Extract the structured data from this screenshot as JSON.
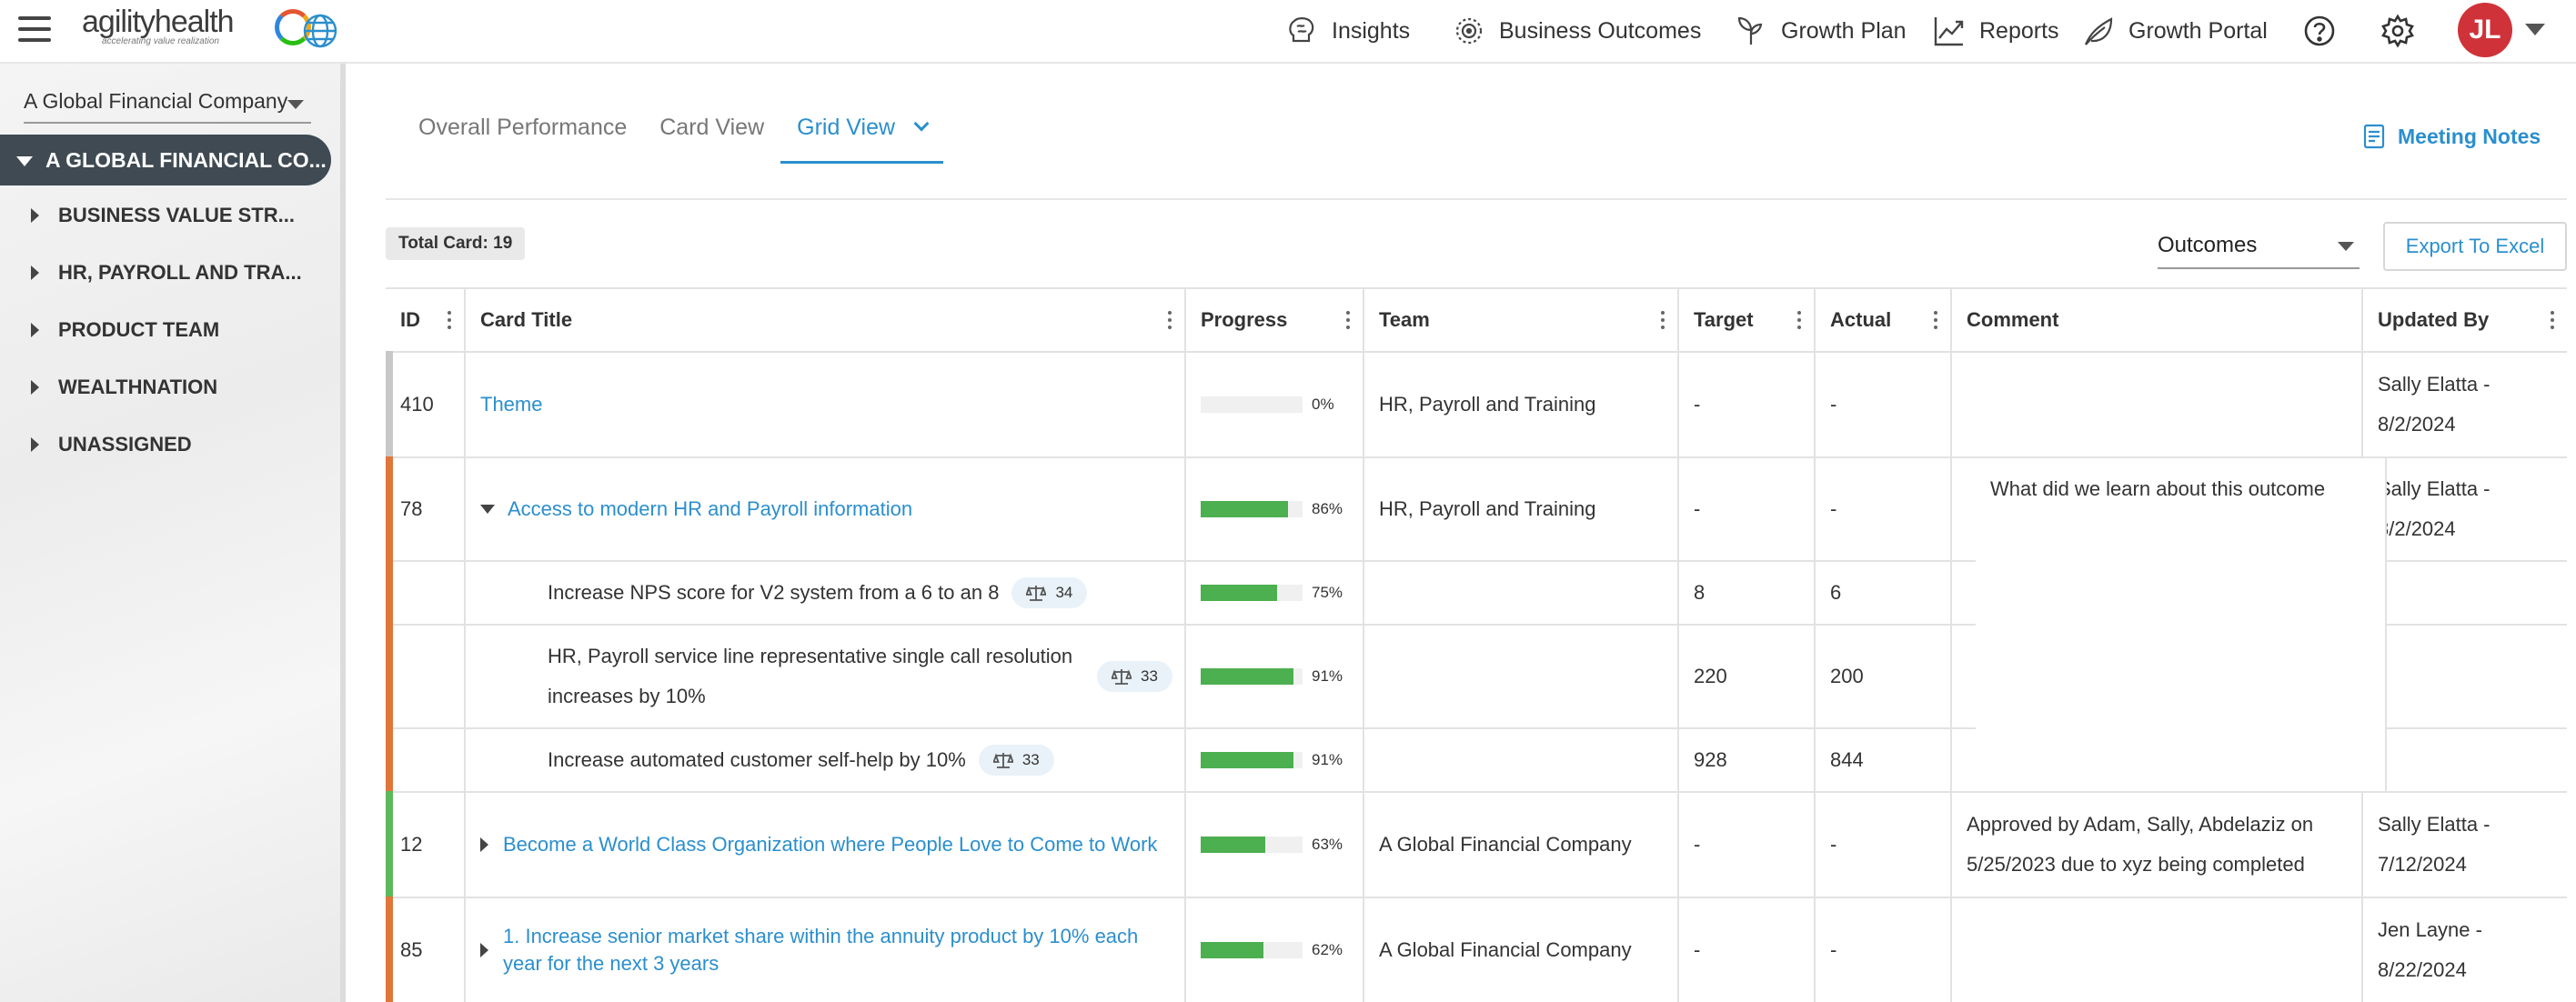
{
  "header": {
    "logo_text": "agilityhealth",
    "logo_tagline": "accelerating value realization",
    "nav": [
      {
        "label": "Insights",
        "icon": "brain-icon"
      },
      {
        "label": "Business Outcomes",
        "icon": "target-icon"
      },
      {
        "label": "Growth Plan",
        "icon": "sprout-icon"
      },
      {
        "label": "Reports",
        "icon": "chart-icon"
      },
      {
        "label": "Growth Portal",
        "icon": "leaf-icon"
      }
    ],
    "avatar_initials": "JL"
  },
  "sidebar": {
    "company": "A Global Financial Company",
    "root": "A GLOBAL FINANCIAL CO...",
    "items": [
      {
        "label": "BUSINESS VALUE STR..."
      },
      {
        "label": "HR, PAYROLL AND TRA..."
      },
      {
        "label": "PRODUCT TEAM"
      },
      {
        "label": "WEALTHNATION"
      },
      {
        "label": "UNASSIGNED"
      }
    ]
  },
  "tabs": [
    {
      "label": "Overall Performance"
    },
    {
      "label": "Card View"
    },
    {
      "label": "Grid View"
    }
  ],
  "meeting_notes": "Meeting Notes",
  "total_card": "Total Card: 19",
  "filter_select": "Outcomes",
  "export_label": "Export To Excel",
  "grid": {
    "headers": {
      "id": "ID",
      "title": "Card Title",
      "progress": "Progress",
      "team": "Team",
      "target": "Target",
      "actual": "Actual",
      "comment": "Comment",
      "updated_by": "Updated By"
    },
    "rows": [
      {
        "id": "410",
        "title": "Theme",
        "progress": "0%",
        "progress_value": 0,
        "team": "HR, Payroll and Training",
        "target": "-",
        "actual": "-",
        "comment": "",
        "updated_by": "Sally Elatta - 8/2/2024",
        "color": "#c8c8c8"
      },
      {
        "id": "78",
        "title": "Access to modern HR and Payroll information",
        "progress": "86%",
        "progress_value": 86,
        "team": "HR, Payroll and Training",
        "target": "-",
        "actual": "-",
        "comment": "What did we learn about this outcome",
        "updated_by": "Sally Elatta - 8/2/2024",
        "color": "#e0763a"
      },
      {
        "kr_title": "Increase NPS score for V2 system from a 6 to an 8",
        "kr_badge": "34",
        "progress": "75%",
        "progress_value": 75,
        "target": "8",
        "actual": "6"
      },
      {
        "kr_title": "HR, Payroll service line representative single call resolution increases by 10%",
        "kr_badge": "33",
        "progress": "91%",
        "progress_value": 91,
        "target": "220",
        "actual": "200"
      },
      {
        "kr_title": "Increase automated customer self-help by 10%",
        "kr_badge": "33",
        "progress": "91%",
        "progress_value": 91,
        "target": "928",
        "actual": "844"
      },
      {
        "id": "12",
        "title": "Become a World Class Organization where People Love to Come to Work",
        "progress": "63%",
        "progress_value": 63,
        "team": "A Global Financial Company",
        "target": "-",
        "actual": "-",
        "comment": "Approved by Adam, Sally, Abdelaziz on 5/25/2023 due to xyz being completed",
        "updated_by": "Sally Elatta - 7/12/2024",
        "color": "#5cb85c"
      },
      {
        "id": "85",
        "title": "1. Increase senior market share within the annuity product by 10% each year for the next 3 years",
        "progress": "62%",
        "progress_value": 62,
        "team": "A Global Financial Company",
        "target": "-",
        "actual": "-",
        "comment": "",
        "updated_by": "Jen Layne - 8/22/2024",
        "color": "#e0763a"
      }
    ]
  },
  "colors": {
    "accent": "#2b8fcd",
    "progress": "#4caf50",
    "avatar": "#d0323a",
    "sidebar_root": "#3f4a52"
  }
}
